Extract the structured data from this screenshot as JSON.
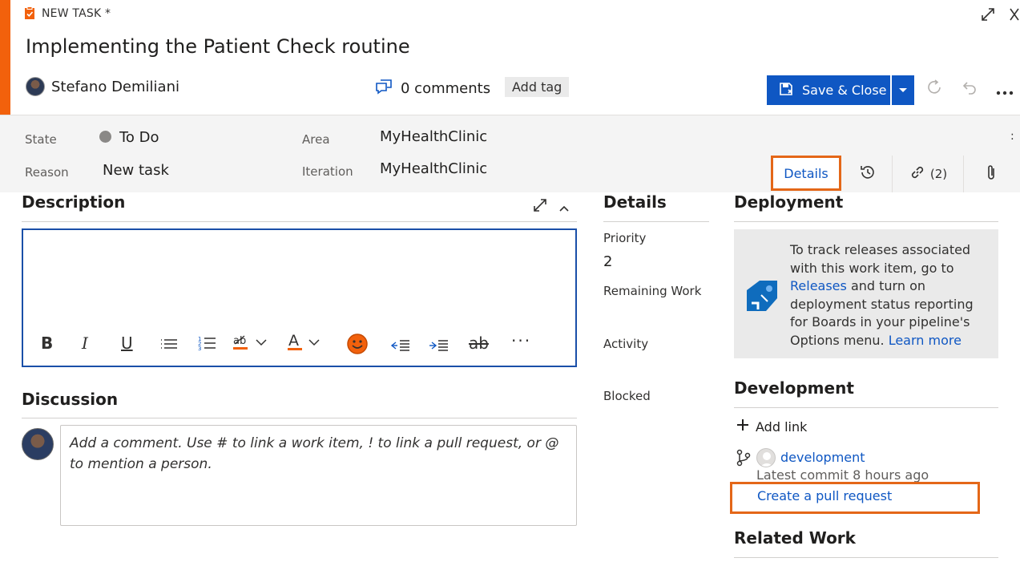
{
  "header": {
    "task_type": "NEW TASK *",
    "title": "Implementing the Patient Check routine",
    "assignee": "Stefano Demiliani",
    "comments": "0 comments",
    "add_tag": "Add tag",
    "save_close": "Save & Close"
  },
  "fields": {
    "state_label": "State",
    "state_value": "To Do",
    "reason_label": "Reason",
    "reason_value": "New task",
    "area_label": "Area",
    "area_value": "MyHealthClinic",
    "iteration_label": "Iteration",
    "iteration_value": "MyHealthClinic"
  },
  "tabs": {
    "details": "Details",
    "links": "(2)"
  },
  "description": {
    "heading": "Description"
  },
  "discussion": {
    "heading": "Discussion",
    "placeholder": "Add a comment. Use # to link a work item, ! to link a pull request, or @ to mention a person."
  },
  "details": {
    "heading": "Details",
    "priority_label": "Priority",
    "priority_value": "2",
    "remaining_label": "Remaining Work",
    "activity_label": "Activity",
    "blocked_label": "Blocked"
  },
  "deployment": {
    "heading": "Deployment",
    "text_1": "To track releases associated with this work item, go to ",
    "releases_link": "Releases",
    "text_2": " and turn on deployment status reporting for Boards in your pipeline's Options menu. ",
    "learn_more": "Learn more"
  },
  "development": {
    "heading": "Development",
    "add_link": "Add link",
    "branch": "development",
    "commit": "Latest commit 8 hours ago",
    "create_pr": "Create a pull request"
  },
  "related": {
    "heading": "Related Work"
  },
  "colors": {
    "accent": "#f2610c",
    "primary": "#0f57c3",
    "highlight": "#e46718"
  }
}
